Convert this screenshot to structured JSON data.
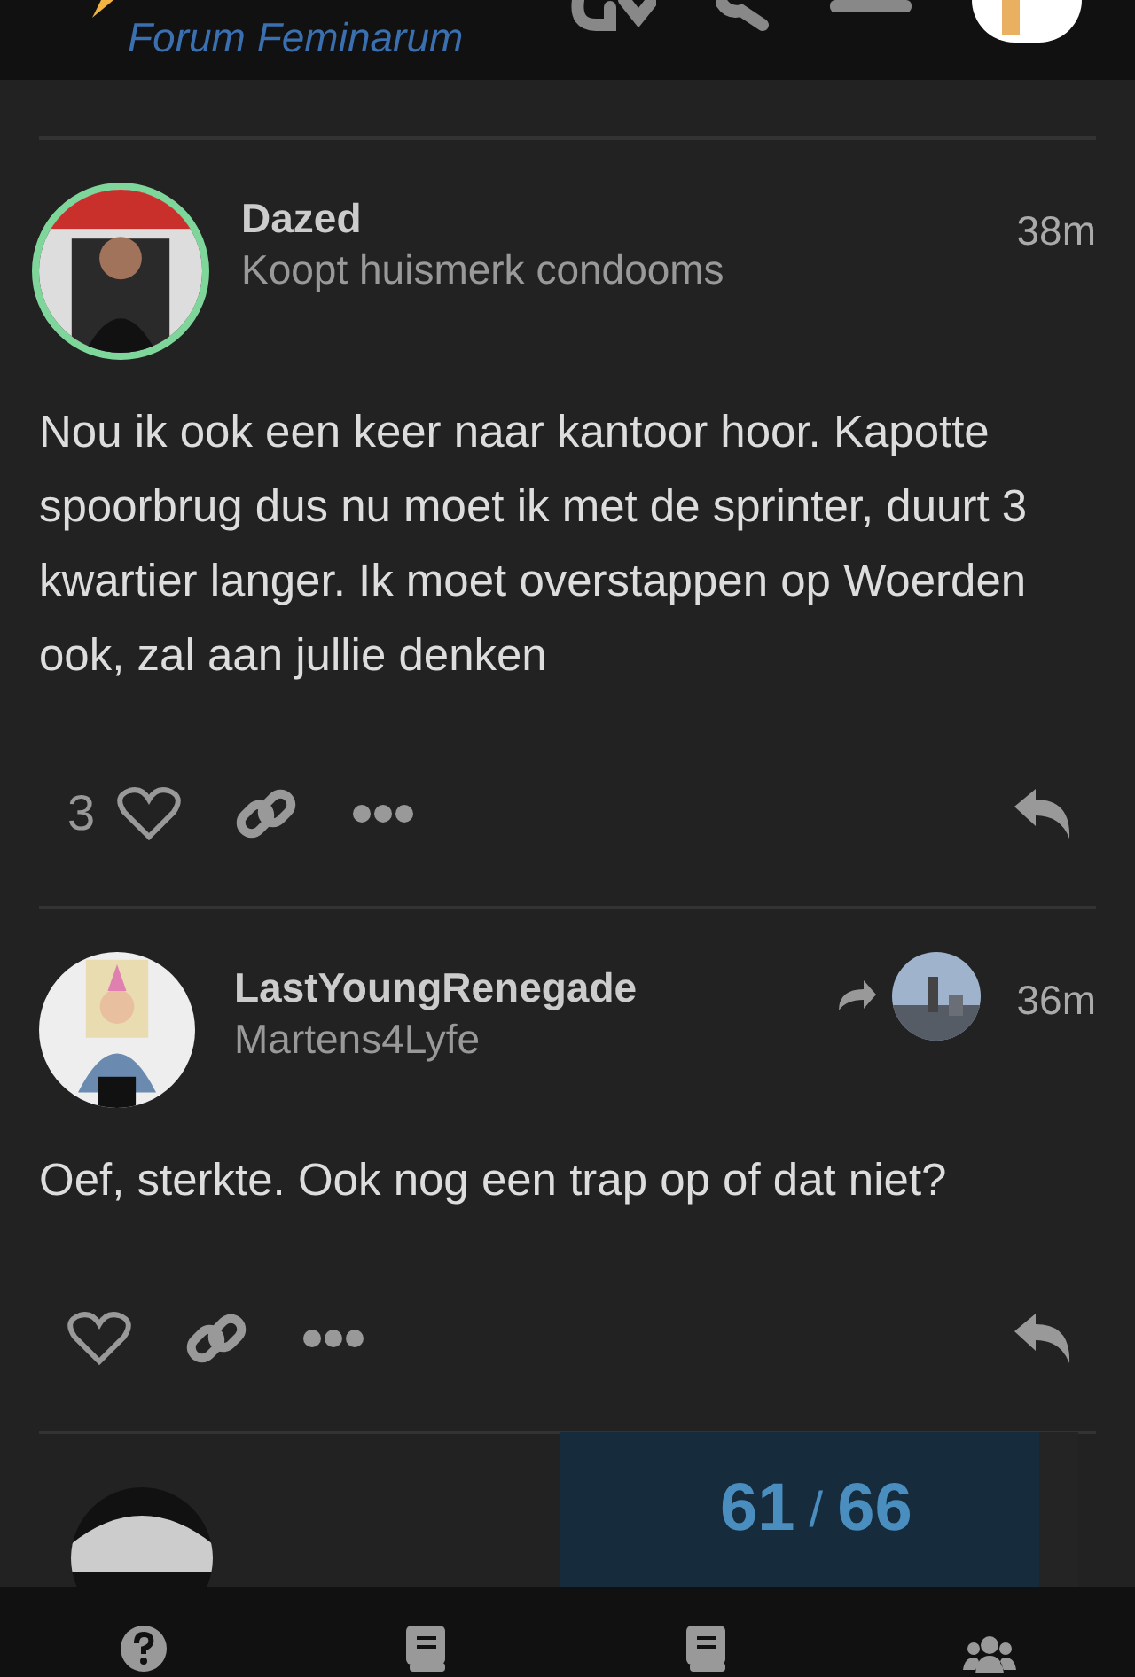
{
  "header": {
    "site_name": "Forum Feminarum"
  },
  "posts": [
    {
      "username": "Dazed",
      "user_title": "Koopt huismerk condooms",
      "time": "38m",
      "highlighted": true,
      "reply_to": false,
      "body": "Nou ik ook een keer naar kantoor hoor. Kapotte spoorbrug dus nu moet ik met de sprinter, duurt 3 kwartier langer. Ik moet overstappen op Woerden ook, zal aan jullie denken",
      "like_count": "3"
    },
    {
      "username": "LastYoungRenegade",
      "user_title": "Martens4Lyfe",
      "time": "36m",
      "highlighted": false,
      "reply_to": true,
      "body": "Oef, sterkte. Ook nog een trap op of dat niet?"
    }
  ],
  "progress": {
    "current": "61",
    "separator": "/",
    "total": "66"
  },
  "nav": [
    {
      "kind": "help"
    },
    {
      "kind": "book"
    },
    {
      "kind": "book"
    },
    {
      "kind": "users"
    }
  ]
}
